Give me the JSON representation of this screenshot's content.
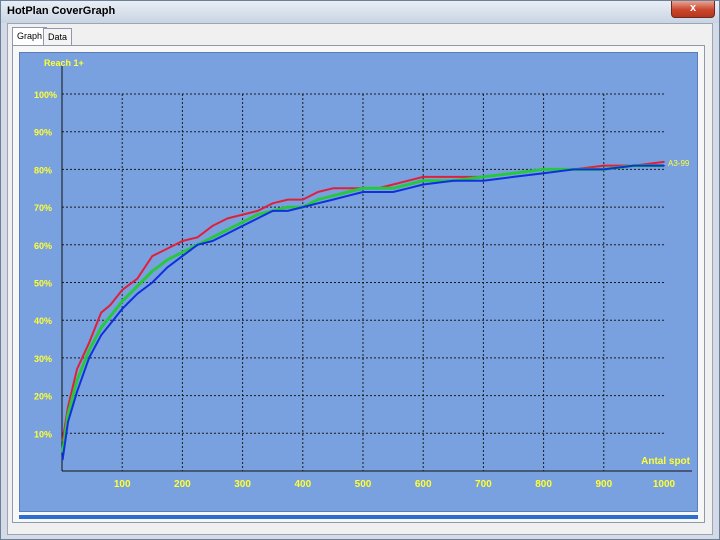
{
  "window": {
    "title": "HotPlan CoverGraph",
    "close_label": "x"
  },
  "tabs": [
    {
      "label": "Graph"
    },
    {
      "label": "Data"
    }
  ],
  "chart_data": {
    "type": "line",
    "ylabel": "Reach 1+",
    "xlabel": "Antal spot",
    "xlim": [
      0,
      1000
    ],
    "ylim": [
      0,
      100
    ],
    "x_ticks": [
      "100",
      "200",
      "300",
      "400",
      "500",
      "600",
      "700",
      "800",
      "900",
      "1000"
    ],
    "y_ticks": [
      "10%",
      "20%",
      "30%",
      "40%",
      "50%",
      "60%",
      "70%",
      "80%",
      "90%",
      "100%"
    ],
    "grid": true,
    "series": [
      {
        "name": "",
        "color": "#e0203a",
        "x": [
          1,
          10,
          25,
          45,
          65,
          80,
          100,
          125,
          150,
          175,
          200,
          225,
          250,
          275,
          300,
          325,
          350,
          375,
          400,
          425,
          450,
          475,
          500,
          525,
          550,
          575,
          600,
          650,
          700,
          750,
          800,
          850,
          900,
          950,
          1000
        ],
        "y": [
          8,
          17,
          27,
          34,
          42,
          44,
          48,
          51,
          57,
          59,
          61,
          62,
          65,
          67,
          68,
          69,
          71,
          72,
          72,
          74,
          75,
          75,
          75,
          75,
          76,
          77,
          78,
          78,
          78,
          79,
          80,
          80,
          81,
          81,
          82
        ]
      },
      {
        "name": "",
        "color": "#27c840",
        "x": [
          1,
          10,
          25,
          45,
          65,
          80,
          100,
          125,
          150,
          175,
          200,
          225,
          250,
          275,
          300,
          325,
          350,
          375,
          400,
          425,
          450,
          475,
          500,
          525,
          550,
          575,
          600,
          650,
          700,
          750,
          800,
          850,
          900,
          950,
          1000
        ],
        "y": [
          5,
          15,
          24,
          32,
          38,
          41,
          45,
          49,
          53,
          56,
          58,
          60,
          62,
          64,
          66,
          68,
          69,
          70,
          70,
          72,
          73,
          74,
          75,
          75,
          75,
          76,
          77,
          77,
          78,
          79,
          80,
          80,
          80,
          81,
          81
        ]
      },
      {
        "name": "",
        "color": "#1030e0",
        "x": [
          1,
          10,
          25,
          45,
          65,
          80,
          100,
          125,
          150,
          175,
          200,
          225,
          250,
          275,
          300,
          325,
          350,
          375,
          400,
          425,
          450,
          475,
          500,
          525,
          550,
          575,
          600,
          650,
          700,
          750,
          800,
          850,
          900,
          950,
          1000
        ],
        "y": [
          3,
          13,
          21,
          30,
          36,
          39,
          43,
          47,
          50,
          54,
          57,
          60,
          61,
          63,
          65,
          67,
          69,
          69,
          70,
          71,
          72,
          73,
          74,
          74,
          74,
          75,
          76,
          77,
          77,
          78,
          79,
          80,
          80,
          81,
          81
        ]
      }
    ],
    "annotations": [
      {
        "text": "A3-99",
        "x": 1000,
        "y": 82
      }
    ],
    "background_color": "#79a1e0",
    "label_color": "#ffff33"
  }
}
